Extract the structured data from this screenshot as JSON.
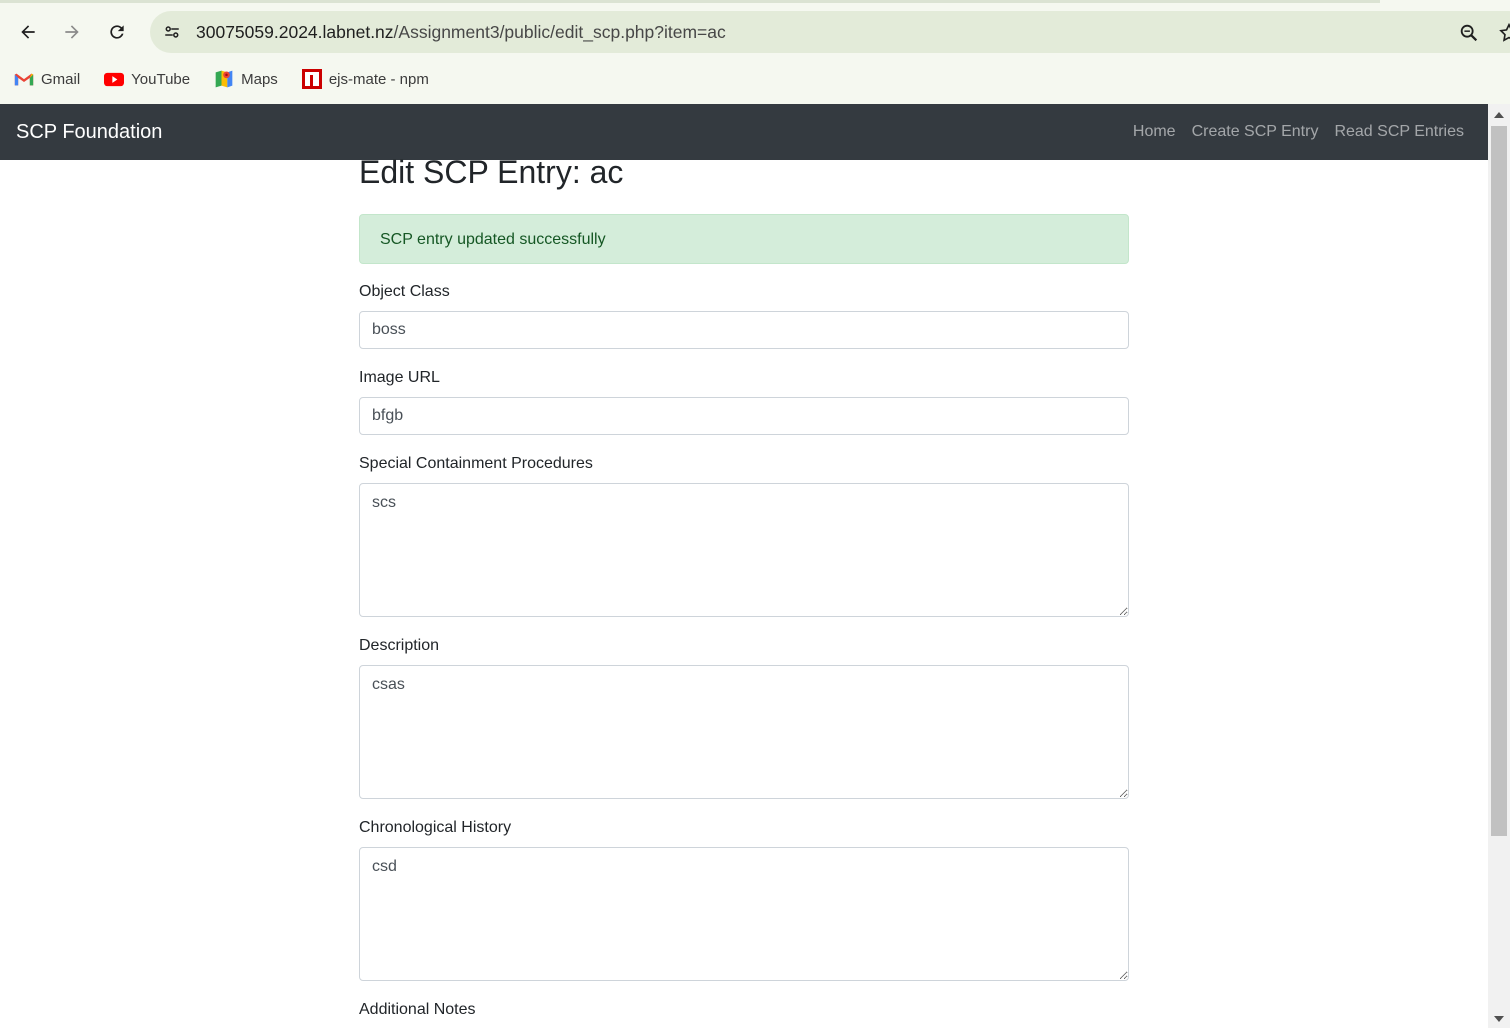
{
  "browser": {
    "url_host": "30075059.2024.labnet.nz",
    "url_path": "/Assignment3/public/edit_scp.php?item=ac",
    "bookmarks": [
      {
        "label": "Gmail",
        "icon": "gmail-icon"
      },
      {
        "label": "YouTube",
        "icon": "youtube-icon"
      },
      {
        "label": "Maps",
        "icon": "maps-icon"
      },
      {
        "label": "ejs-mate - npm",
        "icon": "npm-icon"
      }
    ]
  },
  "navbar": {
    "brand": "SCP Foundation",
    "links": [
      "Home",
      "Create SCP Entry",
      "Read SCP Entries"
    ]
  },
  "page": {
    "title": "Edit SCP Entry: ac",
    "alert": "SCP entry updated successfully",
    "fields": {
      "object_class": {
        "label": "Object Class",
        "value": "boss"
      },
      "image_url": {
        "label": "Image URL",
        "value": "bfgb"
      },
      "containment": {
        "label": "Special Containment Procedures",
        "value": "scs"
      },
      "description": {
        "label": "Description",
        "value": "csas"
      },
      "history": {
        "label": "Chronological History",
        "value": "csd"
      },
      "notes": {
        "label": "Additional Notes"
      }
    }
  },
  "colors": {
    "navbar_bg": "#343a40",
    "alert_bg": "#d4edda",
    "alert_text": "#155724",
    "chrome_bg": "#f5f8f0"
  }
}
